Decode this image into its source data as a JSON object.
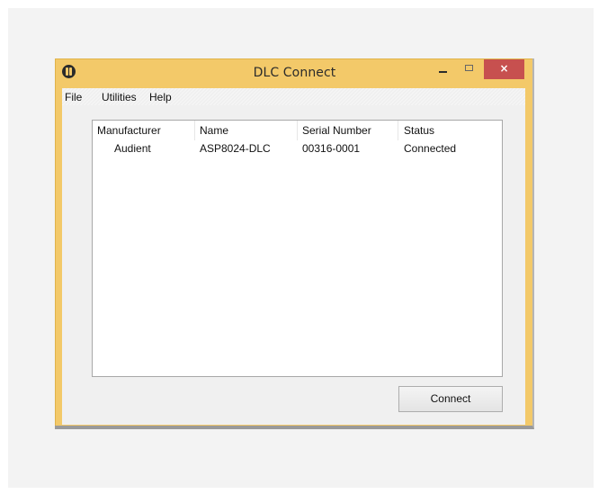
{
  "window": {
    "title": "DLC Connect",
    "close_label": "×"
  },
  "menu": {
    "file": "File",
    "utilities": "Utilities",
    "help": "Help"
  },
  "table": {
    "headers": [
      "Manufacturer",
      "Name",
      "Serial Number",
      "Status"
    ],
    "rows": [
      [
        "Audient",
        "ASP8024-DLC",
        "00316-0001",
        "Connected"
      ]
    ]
  },
  "buttons": {
    "connect": "Connect"
  },
  "colors": {
    "titlebar": "#f3c969",
    "close_button": "#c7504f",
    "background": "#f3f3f3"
  }
}
